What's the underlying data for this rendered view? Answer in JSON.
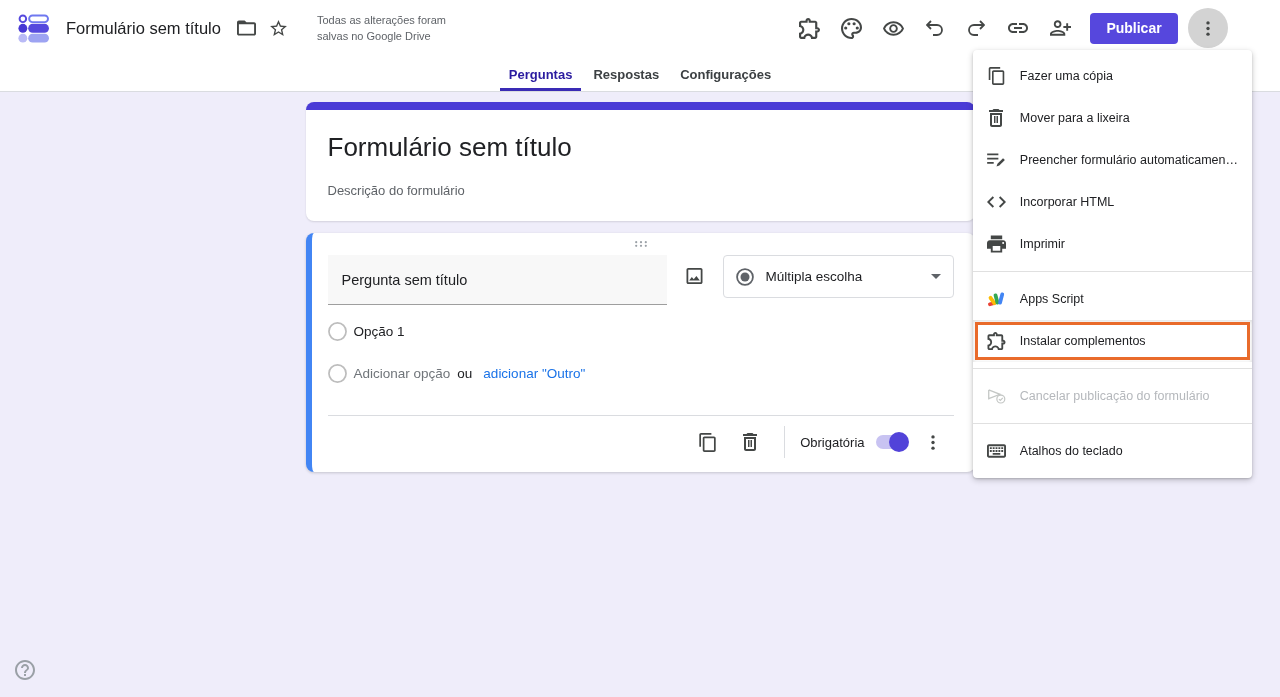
{
  "app": {
    "title": "Formulário sem título",
    "save_status": "Todas as alterações foram salvas no Google Drive",
    "publish_button": "Publicar",
    "more_menu_open": true
  },
  "tabs": [
    {
      "label": "Perguntas",
      "selected": true
    },
    {
      "label": "Respostas",
      "selected": false
    },
    {
      "label": "Configurações",
      "selected": false
    }
  ],
  "form": {
    "title": "Formulário sem título",
    "description": {
      "placeholder": "Descrição do formulário"
    }
  },
  "question": {
    "active": true,
    "title": "Pergunta sem título",
    "type": "Múltipla escolha",
    "options": [
      {
        "label": "Opção 1"
      }
    ],
    "add_option": "Adicionar opção",
    "or_text": "ou",
    "add_other_link": "adicionar \"Outro\"",
    "required_label": "Obrigatória",
    "required": true
  },
  "menu": {
    "sections": [
      {
        "items": [
          {
            "label": "Fazer uma cópia",
            "disabled": false,
            "highlighted": false
          },
          {
            "label": "Mover para a lixeira",
            "disabled": false,
            "highlighted": false
          },
          {
            "label": "Preencher formulário automaticamen…",
            "disabled": false,
            "highlighted": false
          },
          {
            "label": "Incorporar HTML",
            "disabled": false,
            "highlighted": false
          },
          {
            "label": "Imprimir",
            "disabled": false,
            "highlighted": false
          }
        ]
      },
      {
        "items": [
          {
            "label": "Apps Script",
            "disabled": false,
            "highlighted": false
          },
          {
            "label": "Instalar complementos",
            "disabled": false,
            "highlighted": true
          }
        ]
      },
      {
        "items": [
          {
            "label": "Cancelar publicação do formulário",
            "disabled": true,
            "highlighted": false
          }
        ]
      },
      {
        "items": [
          {
            "label": "Atalhos do teclado",
            "disabled": false,
            "highlighted": false
          }
        ]
      }
    ]
  }
}
